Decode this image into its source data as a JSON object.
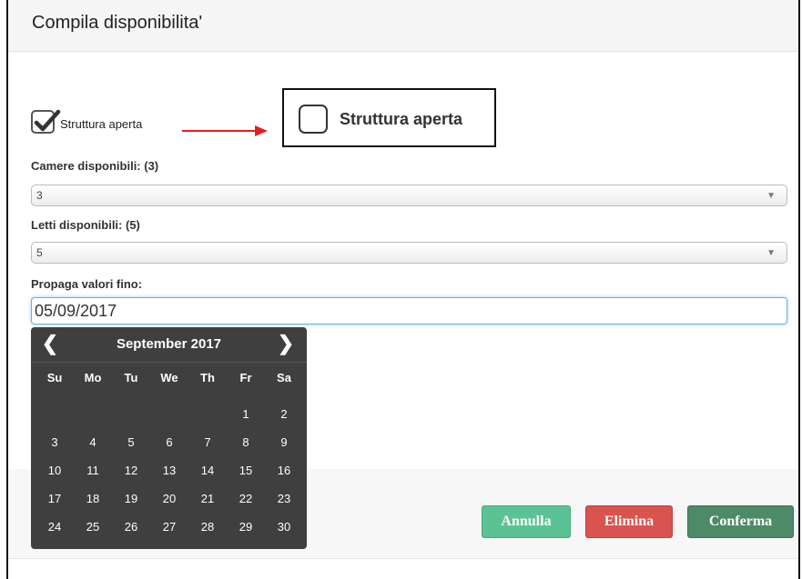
{
  "modal": {
    "title": "Compila disponibilita'"
  },
  "checkbox": {
    "label": "Struttura aperta",
    "checked": true
  },
  "zoom_callout": {
    "label": "Struttura aperta",
    "checked": false
  },
  "camere": {
    "label": "Camere disponibili: (3)",
    "value": "3"
  },
  "letti": {
    "label": "Letti disponibili: (5)",
    "value": "5"
  },
  "propaga": {
    "label": "Propaga valori fino:",
    "value": "05/09/2017"
  },
  "calendar": {
    "month_label": "September 2017",
    "prev": "❮",
    "next": "❯",
    "days_of_week": [
      "Su",
      "Mo",
      "Tu",
      "We",
      "Th",
      "Fr",
      "Sa"
    ],
    "weeks": [
      [
        "",
        "",
        "",
        "",
        "",
        "1",
        "2"
      ],
      [
        "3",
        "4",
        "5",
        "6",
        "7",
        "8",
        "9"
      ],
      [
        "10",
        "11",
        "12",
        "13",
        "14",
        "15",
        "16"
      ],
      [
        "17",
        "18",
        "19",
        "20",
        "21",
        "22",
        "23"
      ],
      [
        "24",
        "25",
        "26",
        "27",
        "28",
        "29",
        "30"
      ]
    ]
  },
  "buttons": {
    "annulla": "Annulla",
    "elimina": "Elimina",
    "conferma": "Conferma"
  },
  "icons": {
    "caret": "▼",
    "arrow_color": "#e02020"
  }
}
